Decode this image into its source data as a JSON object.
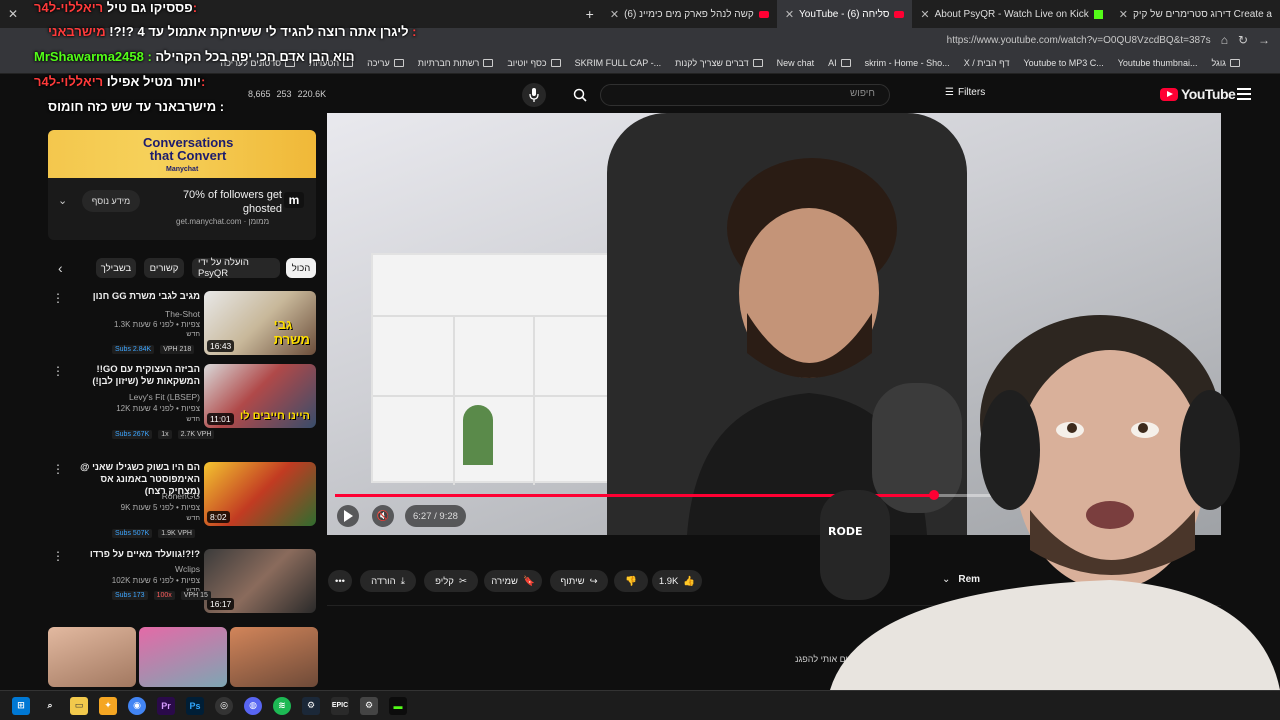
{
  "browser": {
    "tabs": [
      {
        "label": "דירוג סטרימרים של קיק Create a"
      },
      {
        "label": "About PsyQR - Watch Live on Kick"
      },
      {
        "label": "YouTube - סליחה (6)",
        "active": true
      },
      {
        "label": "קשה לנהל פארק מים כימיינ (6)"
      }
    ],
    "url": "https://www.youtube.com/watch?v=O0QU8VzcdBQ&t=387s",
    "bookmarks": [
      "גוגל",
      "Youtube thumbnai...",
      "Youtube to MP3 C...",
      "X / דף הבית",
      "skrim - Home - Sho...",
      "AI",
      "New chat",
      "דברים שצריך לקנות",
      "SKRIM FULL CAP -...",
      "כסף יוטיוב",
      "רשתות חברתיות",
      "עריכה",
      "הטעויות",
      "סרטונים לעריכה"
    ]
  },
  "overlay_chat": {
    "line1_user": "ריאללוי-ל4ר:",
    "line1_msg": "פססיקו גם טיל",
    "line2_user": "מישרבאני :",
    "line2_msg": "ליגרן אתה רוצה להגיד לי ששיחקת אתמול עד 4 ?!?!",
    "line3_user": "MrShawarma2458 :",
    "line3_msg": "הוא הבן אדם הכי יפה בכל הקהילה",
    "line4_user": "ריאללוי-ל4ר:",
    "line4_msg": "יותר מטיל אפילו",
    "line5_user": "חומוס :",
    "line5_msg": "מישרבאנר עד שש כזה"
  },
  "yt_header": {
    "search_placeholder": "חיפוש",
    "filters_label": "Filters",
    "logo_text": "YouTube",
    "stats": {
      "views": "8,665",
      "comments": "253",
      "extra": "220.6K"
    }
  },
  "ad": {
    "headline": "Conversations that Convert",
    "brand_small": "Manychat",
    "title": "70% of followers get ghosted",
    "advertiser": "get.manychat.com · ממומן",
    "cta": "מידע נוסף"
  },
  "chips": [
    "הכול",
    "הועלה על ידי PsyQR",
    "קשורים",
    "בשבילך"
  ],
  "related": [
    {
      "title": "חנון GG מגיב לגבי משרת",
      "channel": "The-Shot",
      "meta": "1.3K צפיות • לפני 6 שעות",
      "new": "חדש",
      "duration": "16:43",
      "subs": "Subs 2.84K",
      "vph": "VPH 218"
    },
    {
      "title": "!!GO הביזה העצוקית עם המשקאות של (שיזון לבן!)",
      "channel": "Levy's Fit (LBSEP)",
      "meta": "12K צפיות • לפני 4 שעות",
      "new": "חדש",
      "duration": "11:01",
      "subs": "Subs 267K",
      "mult": "1x",
      "vph": "2.7K VPH"
    },
    {
      "title": "@ הם היו בשוק כשגילו שאני האימפוסטר באמונג אס (מצחיק רצח)",
      "channel": "RonenGG",
      "meta": "9K צפיות • לפני 5 שעות",
      "new": "חדש",
      "duration": "8:02",
      "subs": "Subs 507K",
      "vph": "1.9K VPH"
    },
    {
      "title": "גוועלד מאיים על פרדו!?!?",
      "channel": "Wclips",
      "meta": "102K צפיות • לפני 6 שעות",
      "new": "חדש",
      "duration": "16:17",
      "subs": "Subs 173",
      "mult": "100x",
      "vph": "VPH 15"
    }
  ],
  "player": {
    "time": "6:27 / 9:28",
    "progress": 0.68
  },
  "actions": {
    "likes": "1.9K",
    "share": "שיתוף",
    "save": "שמירה",
    "clip": "קליפ",
    "download": "הורדה",
    "remix": "Rem"
  },
  "description_snippet": "עוד... מובבים אותי להפגנ",
  "taskbar_icons": [
    "windows-icon",
    "search-icon",
    "file-explorer-icon",
    "puzzle-icon",
    "chrome-icon",
    "premiere-icon",
    "photoshop-icon",
    "obs-icon",
    "discord-icon",
    "spotify-icon",
    "steam-icon",
    "epic-icon",
    "settings-icon",
    "terminal-icon"
  ]
}
